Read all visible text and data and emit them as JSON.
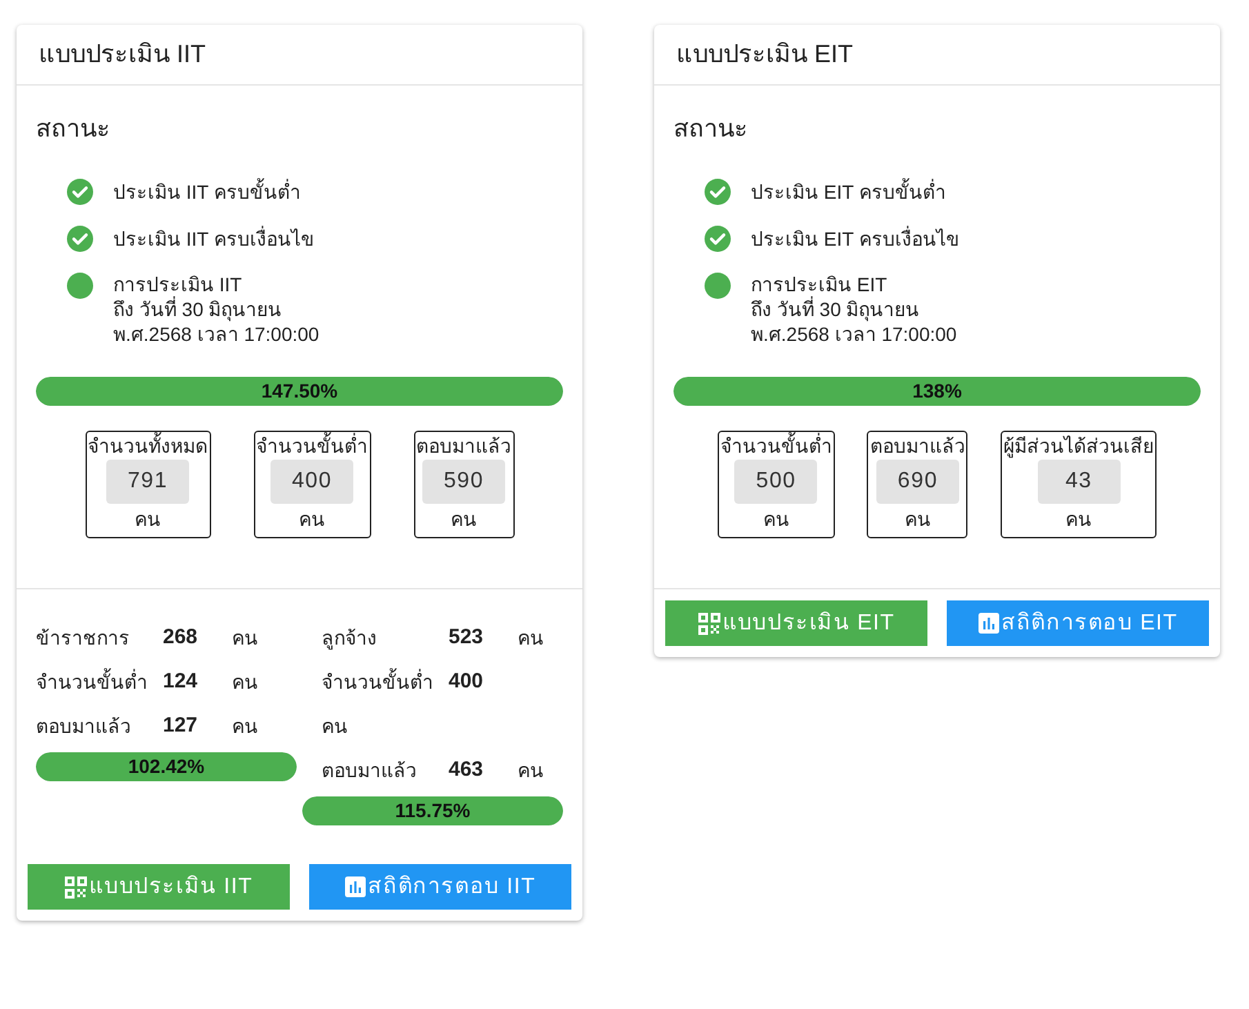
{
  "cards": [
    {
      "title": "แบบประเมิน IIT",
      "status_heading": "สถานะ",
      "status_items": [
        {
          "kind": "check",
          "text": "ประเมิน IIT ครบขั้นต่ำ"
        },
        {
          "kind": "check",
          "text": "ประเมิน IIT ครบเงื่อนไข"
        },
        {
          "kind": "dot",
          "text": "การประเมิน IIT\nถึง วันที่ 30 มิถุนายน\nพ.ศ.2568 เวลา 17:00:00"
        }
      ],
      "progress": {
        "level": 1,
        "label": "147.50%"
      },
      "stats": [
        {
          "label": "จำนวนทั้งหมด",
          "value": "791",
          "unit": "คน"
        },
        {
          "label": "จำนวนขั้นต่ำ",
          "value": "400",
          "unit": "คน"
        },
        {
          "label": "ตอบมาแล้ว",
          "value": "590",
          "unit": "คน"
        }
      ],
      "breakdown": [
        {
          "rows": [
            {
              "label": "ข้าราชการ",
              "value": "268",
              "unit": "คน"
            },
            {
              "label": "จำนวนขั้นต่ำ",
              "value": "124",
              "unit": "คน"
            },
            {
              "label": "ตอบมาแล้ว",
              "value": "127",
              "unit": "คน"
            }
          ],
          "progress": {
            "level": 1,
            "label": "102.42%"
          }
        },
        {
          "rows": [
            {
              "label": "ลูกจ้าง",
              "value": "523",
              "unit": "คน"
            },
            {
              "label": "จำนวนขั้นต่ำ",
              "value": "400"
            },
            {
              "label": "คน"
            },
            {
              "label": "ตอบมาแล้ว",
              "value": "463",
              "unit": "คน"
            }
          ],
          "progress": {
            "level": 1,
            "label": "115.75%"
          }
        }
      ],
      "buttons": [
        {
          "kind": "qr",
          "label": "แบบประเมิน IIT"
        },
        {
          "kind": "stats",
          "label": "สถิติการตอบ IIT"
        }
      ]
    },
    {
      "title": "แบบประเมิน EIT",
      "status_heading": "สถานะ",
      "status_items": [
        {
          "kind": "check",
          "text": "ประเมิน EIT ครบขั้นต่ำ"
        },
        {
          "kind": "check",
          "text": "ประเมิน EIT ครบเงื่อนไข"
        },
        {
          "kind": "dot",
          "text": "การประเมิน EIT\nถึง วันที่ 30 มิถุนายน\nพ.ศ.2568 เวลา 17:00:00"
        }
      ],
      "progress": {
        "level": 1,
        "label": "138%"
      },
      "stats": [
        {
          "label": "จำนวนขั้นต่ำ",
          "value": "500",
          "unit": "คน"
        },
        {
          "label": "ตอบมาแล้ว",
          "value": "690",
          "unit": "คน"
        },
        {
          "label": "ผู้มีส่วนได้ส่วนเสีย",
          "value": "43",
          "unit": "คน"
        }
      ],
      "buttons": [
        {
          "kind": "qr",
          "label": "แบบประเมิน EIT"
        },
        {
          "kind": "stats",
          "label": "สถิติการตอบ EIT"
        }
      ]
    }
  ]
}
